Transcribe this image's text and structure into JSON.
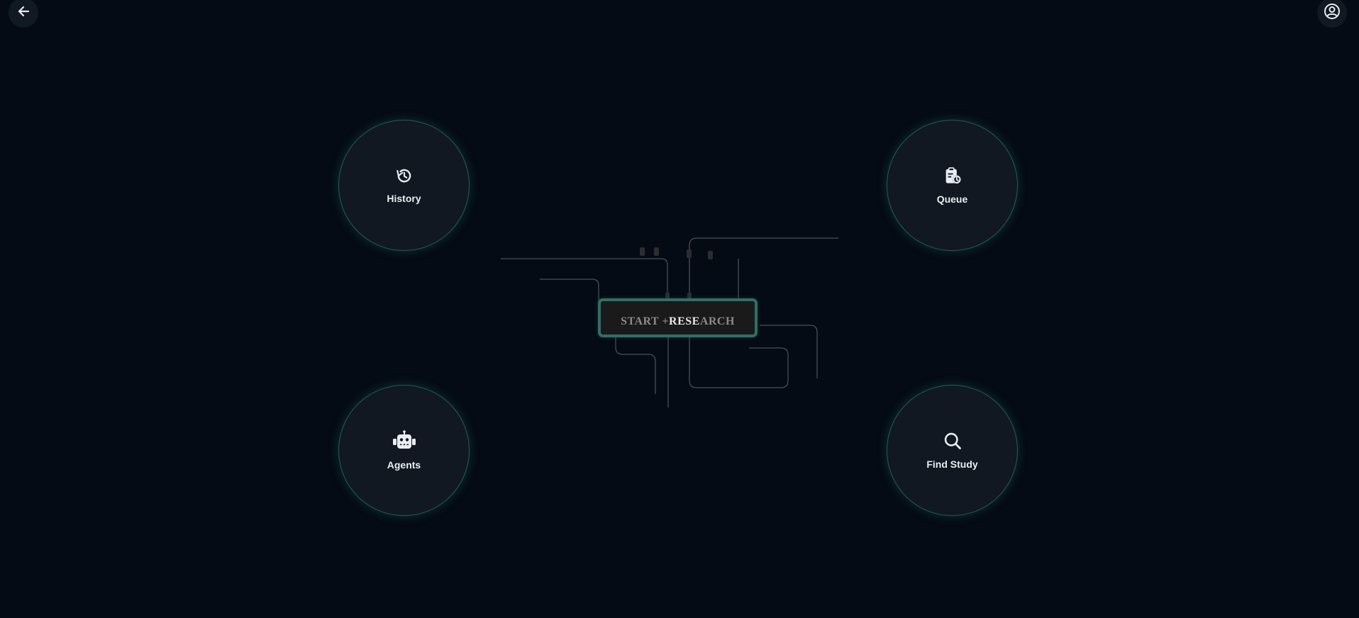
{
  "header": {
    "back_icon": "arrow-left-icon",
    "account_icon": "user-circle-icon"
  },
  "center": {
    "part1": "START + ",
    "part2": "RESE",
    "part3": "ARCH"
  },
  "nav": {
    "history": {
      "label": "History",
      "icon": "history-icon"
    },
    "queue": {
      "label": "Queue",
      "icon": "clipboard-clock-icon"
    },
    "agents": {
      "label": "Agents",
      "icon": "robot-icon"
    },
    "find_study": {
      "label": "Find Study",
      "icon": "search-icon"
    }
  },
  "colors": {
    "background": "#050b14",
    "accent": "#2f6f66",
    "circle_fill": "#111821",
    "text": "#e9edf2"
  }
}
